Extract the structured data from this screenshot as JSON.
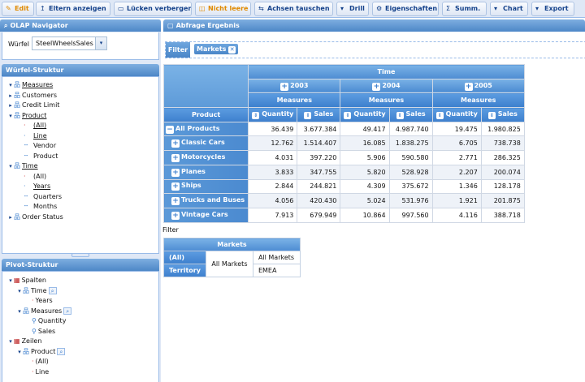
{
  "toolbar": {
    "buttons": [
      {
        "label": "Edit",
        "icon": "✎"
      },
      {
        "label": "Eltern anzeigen",
        "icon": "↥"
      },
      {
        "label": "Lücken verbergen",
        "icon": "▭"
      },
      {
        "label": "Nicht leere",
        "icon": "◫"
      },
      {
        "label": "Achsen tauschen",
        "icon": "⇆"
      },
      {
        "label": "Drill",
        "icon": "▾"
      },
      {
        "label": "Eigenschaften",
        "icon": "⚙"
      },
      {
        "label": "Summ.",
        "icon": "Σ"
      },
      {
        "label": "Chart",
        "icon": "▾"
      },
      {
        "label": "Export",
        "icon": "▾"
      }
    ]
  },
  "navigator": {
    "title": "OLAP Navigator",
    "cube_label": "Würfel",
    "cube_value": "SteelWheelsSales"
  },
  "cube_structure": {
    "title": "Würfel-Struktur",
    "items": [
      {
        "label": "Measures",
        "level": 0,
        "expanded": true,
        "underline": true
      },
      {
        "label": "Customers",
        "level": 0
      },
      {
        "label": "Credit Limit",
        "level": 0
      },
      {
        "label": "Product",
        "level": 0,
        "expanded": true,
        "underline": true
      },
      {
        "label": "(All)",
        "level": 1,
        "underline": true
      },
      {
        "label": "Line",
        "level": 1,
        "underline": true
      },
      {
        "label": "Vendor",
        "level": 1
      },
      {
        "label": "Product",
        "level": 1
      },
      {
        "label": "Time",
        "level": 0,
        "expanded": true,
        "underline": true
      },
      {
        "label": "(All)",
        "level": 1
      },
      {
        "label": "Years",
        "level": 1,
        "underline": true
      },
      {
        "label": "Quarters",
        "level": 1
      },
      {
        "label": "Months",
        "level": 1
      },
      {
        "label": "Order Status",
        "level": 0
      }
    ]
  },
  "pivot_structure": {
    "title": "Pivot-Struktur",
    "items": [
      {
        "label": "Spalten",
        "level": 0,
        "kind": "table"
      },
      {
        "label": "Time",
        "level": 1,
        "kind": "dim",
        "search": true
      },
      {
        "label": "Years",
        "level": 2,
        "kind": "member"
      },
      {
        "label": "Measures",
        "level": 1,
        "kind": "dim",
        "search": true
      },
      {
        "label": "Quantity",
        "level": 2,
        "kind": "measure"
      },
      {
        "label": "Sales",
        "level": 2,
        "kind": "measure"
      },
      {
        "label": "Zeilen",
        "level": 0,
        "kind": "table"
      },
      {
        "label": "Product",
        "level": 1,
        "kind": "dim",
        "search": true
      },
      {
        "label": "(All)",
        "level": 2,
        "kind": "member"
      },
      {
        "label": "Line",
        "level": 2,
        "kind": "member"
      }
    ]
  },
  "result": {
    "title": "Abfrage Ergebnis",
    "filter_label": "Filter",
    "filter_chip": "Markets",
    "time_header": "Time",
    "product_header": "Product",
    "measures_label": "Measures",
    "years": [
      "2003",
      "2004",
      "2005"
    ],
    "measures": [
      "Quantity",
      "Sales"
    ],
    "rows": [
      {
        "label": "All Products",
        "icon": "−",
        "values": [
          "36.439",
          "3.677.384",
          "49.417",
          "4.987.740",
          "19.475",
          "1.980.825"
        ]
      },
      {
        "label": "Classic Cars",
        "icon": "+",
        "values": [
          "12.762",
          "1.514.407",
          "16.085",
          "1.838.275",
          "6.705",
          "738.738"
        ]
      },
      {
        "label": "Motorcycles",
        "icon": "+",
        "values": [
          "4.031",
          "397.220",
          "5.906",
          "590.580",
          "2.771",
          "286.325"
        ]
      },
      {
        "label": "Planes",
        "icon": "+",
        "values": [
          "3.833",
          "347.755",
          "5.820",
          "528.928",
          "2.207",
          "200.074"
        ]
      },
      {
        "label": "Ships",
        "icon": "+",
        "values": [
          "2.844",
          "244.821",
          "4.309",
          "375.672",
          "1.346",
          "128.178"
        ]
      },
      {
        "label": "Trucks and Buses",
        "icon": "+",
        "values": [
          "4.056",
          "420.430",
          "5.024",
          "531.976",
          "1.921",
          "201.875"
        ]
      },
      {
        "label": "Vintage Cars",
        "icon": "+",
        "values": [
          "7.913",
          "679.949",
          "10.864",
          "997.560",
          "4.116",
          "388.718"
        ]
      }
    ]
  },
  "filter_section": {
    "label": "Filter",
    "markets_header": "Markets",
    "all_label": "(All)",
    "territory_label": "Territory",
    "all_markets": "All Markets",
    "all_markets_sub": "All Markets",
    "emea": "EMEA"
  }
}
